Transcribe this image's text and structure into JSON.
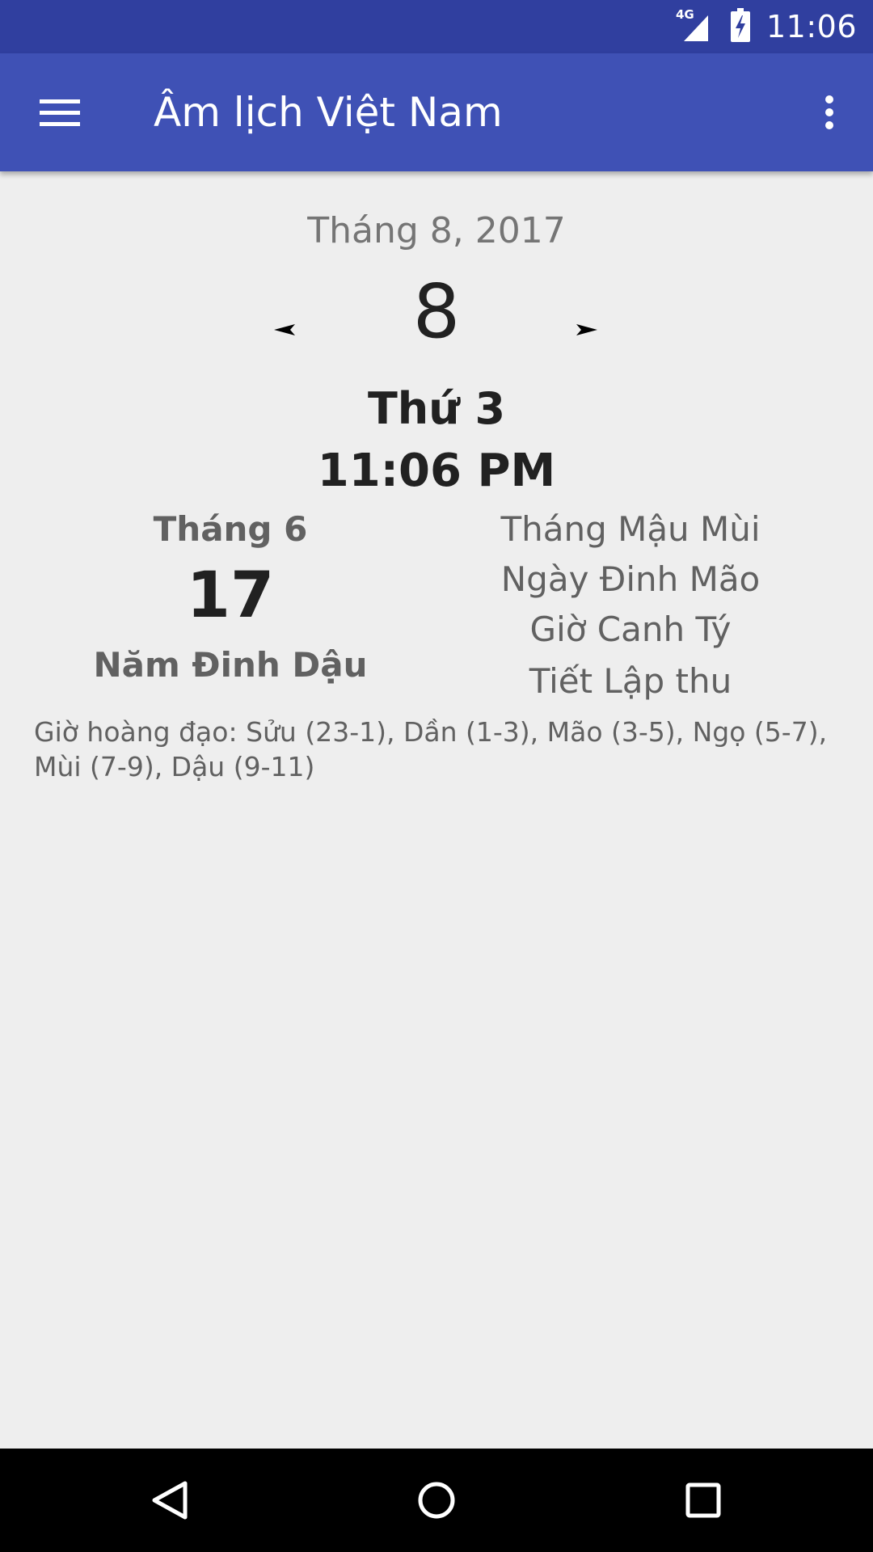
{
  "status_bar": {
    "network_type": "4G",
    "time": "11:06",
    "icons": [
      "signal-icon",
      "battery-charging-icon"
    ]
  },
  "app_bar": {
    "title": "Âm lịch Việt Nam",
    "menu_icon": "hamburger-menu-icon",
    "more_icon": "more-vertical-icon"
  },
  "solar": {
    "month_year": "Tháng 8, 2017",
    "day": "8",
    "weekday": "Thứ 3",
    "time": "11:06 PM"
  },
  "lunar": {
    "month": "Tháng 6",
    "day": "17",
    "year": "Năm Đinh Dậu"
  },
  "can_chi": {
    "month": "Tháng Mậu Mùi",
    "day": "Ngày Đinh Mão",
    "hour": "Giờ Canh Tý",
    "solar_term": "Tiết Lập thu"
  },
  "auspicious_hours": "Giờ hoàng đạo: Sửu (23-1), Dần (1-3), Mão (3-5), Ngọ (5-7), Mùi (7-9), Dậu (9-11)",
  "nav_bar": {
    "icons": [
      "back-icon",
      "home-icon",
      "recent-apps-icon"
    ]
  },
  "colors": {
    "status_bar": "#303f9f",
    "app_bar": "#3f51b5",
    "background": "#eeeeee"
  }
}
